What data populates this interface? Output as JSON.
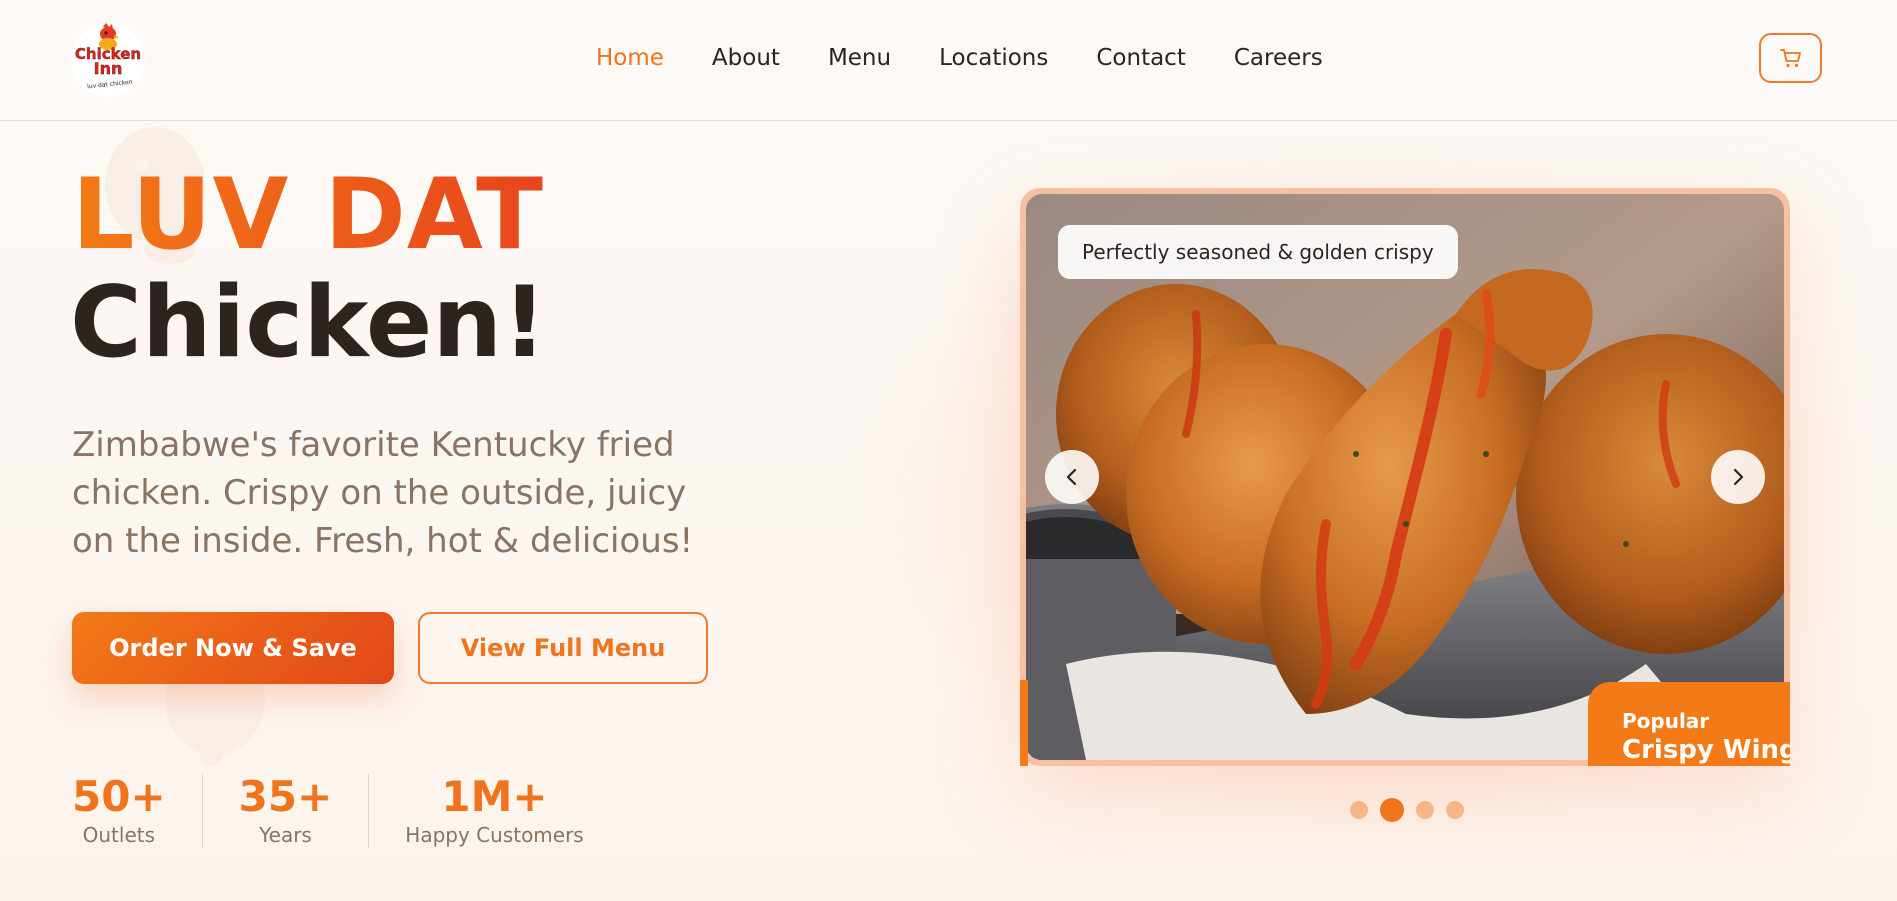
{
  "brand": {
    "logo_text_1": "Chicken",
    "logo_text_2": "Inn",
    "logo_tagline": "luv dat chicken"
  },
  "nav": {
    "items": [
      {
        "label": "Home",
        "active": true
      },
      {
        "label": "About",
        "active": false
      },
      {
        "label": "Menu",
        "active": false
      },
      {
        "label": "Locations",
        "active": false
      },
      {
        "label": "Contact",
        "active": false
      },
      {
        "label": "Careers",
        "active": false
      }
    ]
  },
  "header": {
    "cart_icon": "cart-icon"
  },
  "hero": {
    "title_line1": "LUV DAT",
    "title_line2": "Chicken!",
    "description": "Zimbabwe's favorite Kentucky fried chicken. Crispy on the outside, juicy on the inside. Fresh, hot & delicious!",
    "primary_button": "Order Now & Save",
    "secondary_button": "View Full Menu"
  },
  "stats": [
    {
      "value": "50+",
      "label": "Outlets"
    },
    {
      "value": "35+",
      "label": "Years"
    },
    {
      "value": "1M+",
      "label": "Happy Customers"
    }
  ],
  "carousel": {
    "caption": "Perfectly seasoned & golden crispy",
    "badge_label": "Popular",
    "badge_title": "Crispy Wings",
    "prev_icon": "chevron-left-icon",
    "next_icon": "chevron-right-icon",
    "slide_count": 4,
    "active_slide": 2
  },
  "colors": {
    "accent": "#f0741c",
    "accent_dark": "#e2461a",
    "text_dark": "#2d2320",
    "text_muted": "#8a7365",
    "background": "#fcf9f6"
  }
}
